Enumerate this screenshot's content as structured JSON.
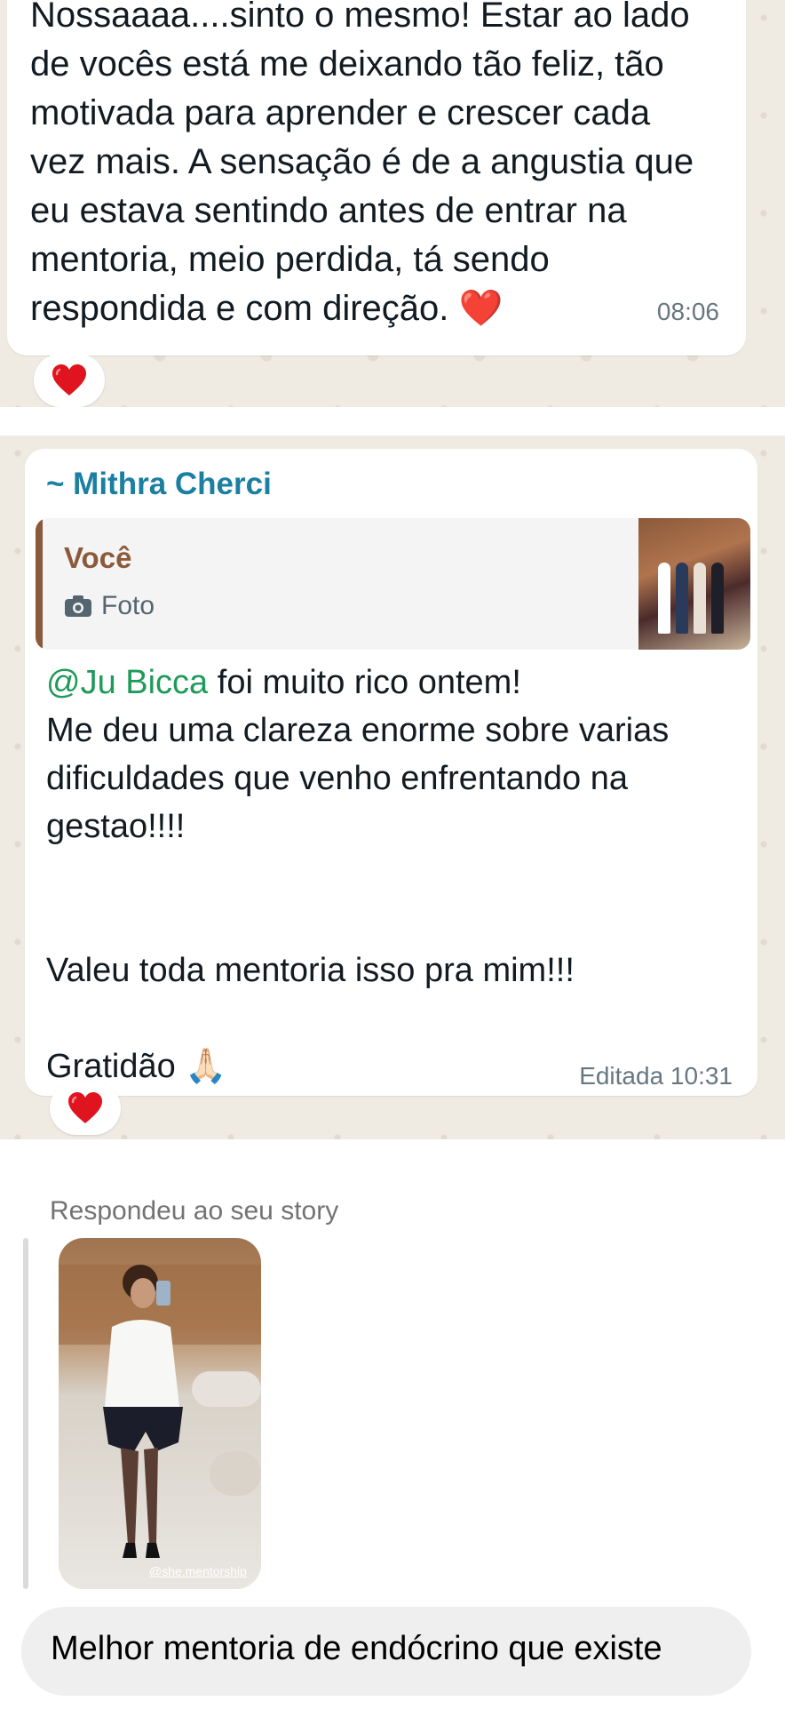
{
  "message1": {
    "text": "Nossaaaa....sinto o mesmo! Estar ao lado\nde vocês está me deixando tão feliz, tão\nmotivada para aprender e crescer cada\nvez mais. A sensação é de a angustia que\neu estava sentindo antes de entrar na\nmentoria, meio perdida, tá sendo\nrespondida e com direção. ❤️",
    "time": "08:06",
    "reaction": "heart-icon"
  },
  "message2": {
    "sender": "~ Mithra Cherci",
    "quote": {
      "author": "Você",
      "type_label": "Foto",
      "icon": "camera-icon"
    },
    "mention": "@Ju Bicca",
    "line1_rest": " foi muito rico ontem!",
    "line2": "Me deu uma clareza enorme sobre varias\ndificuldades que venho enfrentando na\ngestao!!!!",
    "line3": "Valeu toda mentoria isso pra mim!!!",
    "line4": "Gratidão 🙏🏻",
    "time": "Editada 10:31",
    "reaction": "heart-icon"
  },
  "story": {
    "label": "Respondeu ao seu story",
    "handle": "@she.mentorship",
    "reply": "Melhor mentoria de endócrino que existe"
  },
  "colors": {
    "chat_bg": "#efeae2",
    "sender": "#1a7fa0",
    "mention": "#1f9a5a",
    "quote_accent": "#8a5a3b"
  }
}
